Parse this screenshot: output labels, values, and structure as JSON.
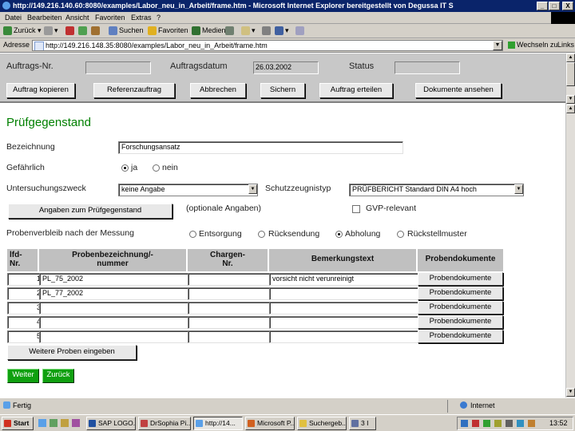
{
  "window": {
    "title": "http://149.216.140.60:8080/examples/Labor_neu_in_Arbeit/frame.htm - Microsoft Internet Explorer bereitgestellt von Degussa IT S",
    "minimize": "_",
    "maximize": "□",
    "close": "X"
  },
  "menu": [
    "Datei",
    "Bearbeiten",
    "Ansicht",
    "Favoriten",
    "Extras",
    "?"
  ],
  "toolbar": {
    "back": "Zurück",
    "search": "Suchen",
    "favorites": "Favoriten",
    "media": "Medien"
  },
  "address": {
    "label": "Adresse",
    "url": "http://149.216.148.35:8080/examples/Labor_neu_in_Arbeit/frame.htm",
    "go": "Wechseln zu",
    "links": "Links"
  },
  "header_form": {
    "order_no_label": "Auftrags-Nr.",
    "order_no_value": "",
    "order_date_label": "Auftragsdatum",
    "order_date_value": "26.03.2002",
    "status_label": "Status",
    "status_value": "",
    "buttons": [
      "Auftrag kopieren",
      "Referenzauftrag",
      "Abbrechen",
      "Sichern",
      "Auftrag erteilen",
      "Dokumente ansehen"
    ]
  },
  "section_title": "Prüfgegenstand",
  "form": {
    "designation_label": "Bezeichnung",
    "designation_value": "Forschungsansatz",
    "hazard_label": "Gefährlich",
    "hazard_yes": "ja",
    "hazard_no": "nein",
    "purpose_label": "Untersuchungszweck",
    "purpose_value": "keine Angabe",
    "certificate_label": "Schutzzeugnistyp",
    "certificate_value": "PRÜFBERICHT Standard DIN A4 hoch",
    "details_button": "Angaben zum Prüfgegenstand",
    "optional_note": "(optionale Angaben)",
    "gvp_label": "GVP-relevant",
    "after_measure_label": "Probenverbleib nach der Messung",
    "after_measure_options": [
      "Entsorgung",
      "Rücksendung",
      "Abholung",
      "Rückstellmuster"
    ],
    "after_measure_selected": 2
  },
  "table": {
    "headers": {
      "no": "lfd-\nNr.",
      "sample": "Probenbezeichnung/-\nnummer",
      "batch": "Chargen-\nNr.",
      "remark": "Bemerkungstext",
      "docs": "Probendokumente"
    },
    "rows": [
      {
        "no": "1",
        "sample": "PL_75_2002",
        "batch": "",
        "remark": "vorsicht nicht verunreinigt",
        "docs": "Probendokumente"
      },
      {
        "no": "2",
        "sample": "PL_77_2002",
        "batch": "",
        "remark": "",
        "docs": "Probendokumente"
      },
      {
        "no": "3",
        "sample": "",
        "batch": "",
        "remark": "",
        "docs": "Probendokumente"
      },
      {
        "no": "4",
        "sample": "",
        "batch": "",
        "remark": "",
        "docs": "Probendokumente"
      },
      {
        "no": "5",
        "sample": "",
        "batch": "",
        "remark": "",
        "docs": "Probendokumente"
      }
    ],
    "more_button": "Weitere Proben eingeben"
  },
  "bottom_buttons": {
    "next": "Weiter",
    "back": "Zurück"
  },
  "status": {
    "left": "Fertig",
    "zone": "Internet"
  },
  "taskbar": {
    "start": "Start",
    "tasks": [
      "SAP LOGO...",
      "DrSophia Pi...",
      "http://14...",
      "Microsoft P...",
      "Suchergeb...",
      "3 I"
    ],
    "active_task": 2,
    "clock": "13:52"
  },
  "colors": {
    "titlebar": "#0a246a",
    "chrome": "#d4d0c8",
    "section_title": "#008000",
    "green_button": "#10a010"
  }
}
